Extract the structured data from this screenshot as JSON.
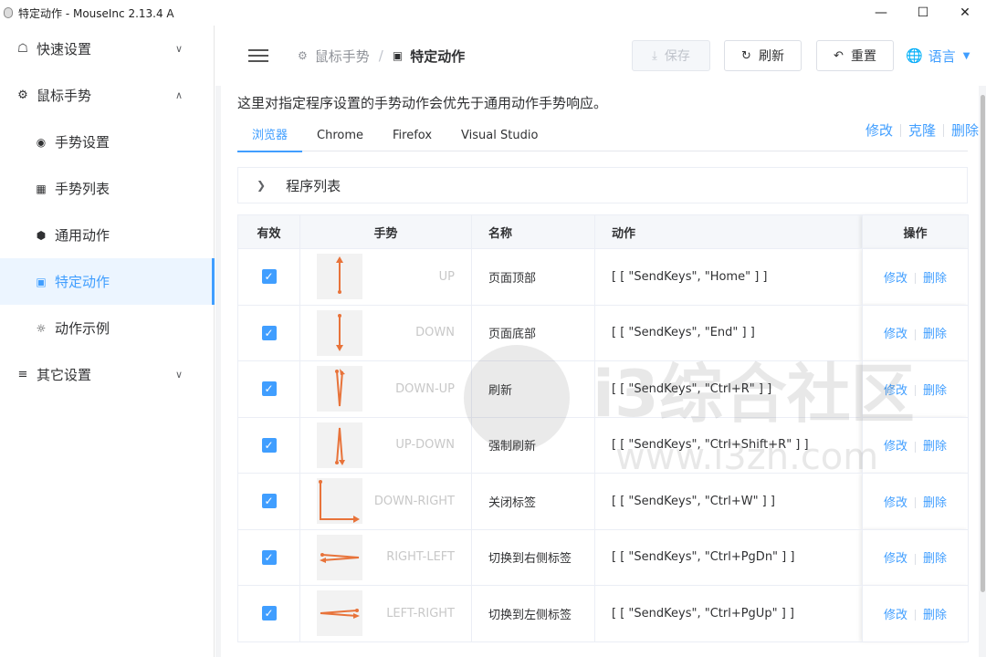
{
  "window": {
    "title": "特定动作 - MouseInc 2.13.4 A",
    "minimize": "—",
    "maximize": "☐",
    "close": "✕"
  },
  "sidebar": {
    "groups": [
      {
        "label": "快速设置",
        "icon": "home-icon",
        "chevron": "∨"
      },
      {
        "label": "鼠标手势",
        "icon": "gear-icon",
        "chevron": "∧"
      },
      {
        "label": "其它设置",
        "icon": "sliders-icon",
        "chevron": "∨"
      }
    ],
    "items": [
      {
        "label": "手势设置",
        "icon": "palette-icon"
      },
      {
        "label": "手势列表",
        "icon": "grid-icon"
      },
      {
        "label": "通用动作",
        "icon": "cube-icon"
      },
      {
        "label": "特定动作",
        "icon": "briefcase-icon",
        "active": true
      },
      {
        "label": "动作示例",
        "icon": "sun-icon"
      }
    ]
  },
  "header": {
    "breadcrumb": [
      "鼠标手势",
      "特定动作"
    ],
    "breadcrumb_sep": "/",
    "save": "保存",
    "refresh": "刷新",
    "reset": "重置",
    "language": "语言"
  },
  "main": {
    "description": "这里对指定程序设置的手势动作会优先于通用动作手势响应。",
    "tabs": [
      "浏览器",
      "Chrome",
      "Firefox",
      "Visual Studio"
    ],
    "active_tab": 0,
    "tab_actions": [
      "修改",
      "克隆",
      "删除"
    ],
    "collapse_label": "程序列表",
    "table": {
      "headers": [
        "有效",
        "手势",
        "名称",
        "动作",
        "操作"
      ],
      "row_ops": [
        "修改",
        "删除"
      ],
      "rows": [
        {
          "enabled": true,
          "gesture": "UP",
          "name": "页面顶部",
          "action": "[ [ \"SendKeys\", \"Home\" ] ]"
        },
        {
          "enabled": true,
          "gesture": "DOWN",
          "name": "页面底部",
          "action": "[ [ \"SendKeys\", \"End\" ] ]"
        },
        {
          "enabled": true,
          "gesture": "DOWN-UP",
          "name": "刷新",
          "action": "[ [ \"SendKeys\", \"Ctrl+R\" ] ]"
        },
        {
          "enabled": true,
          "gesture": "UP-DOWN",
          "name": "强制刷新",
          "action": "[ [ \"SendKeys\", \"Ctrl+Shift+R\" ] ]"
        },
        {
          "enabled": true,
          "gesture": "DOWN-RIGHT",
          "name": "关闭标签",
          "action": "[ [ \"SendKeys\", \"Ctrl+W\" ] ]"
        },
        {
          "enabled": true,
          "gesture": "RIGHT-LEFT",
          "name": "切换到右侧标签",
          "action": "[ [ \"SendKeys\", \"Ctrl+PgDn\" ] ]"
        },
        {
          "enabled": true,
          "gesture": "LEFT-RIGHT",
          "name": "切换到左侧标签",
          "action": "[ [ \"SendKeys\", \"Ctrl+PgUp\" ] ]"
        }
      ]
    }
  },
  "watermark": {
    "line1": "i3综合社区",
    "line2": "www.i3zh.com"
  },
  "colors": {
    "accent": "#409eff",
    "gesture_stroke": "#e8733a",
    "active_bg": "#ecf5ff"
  }
}
